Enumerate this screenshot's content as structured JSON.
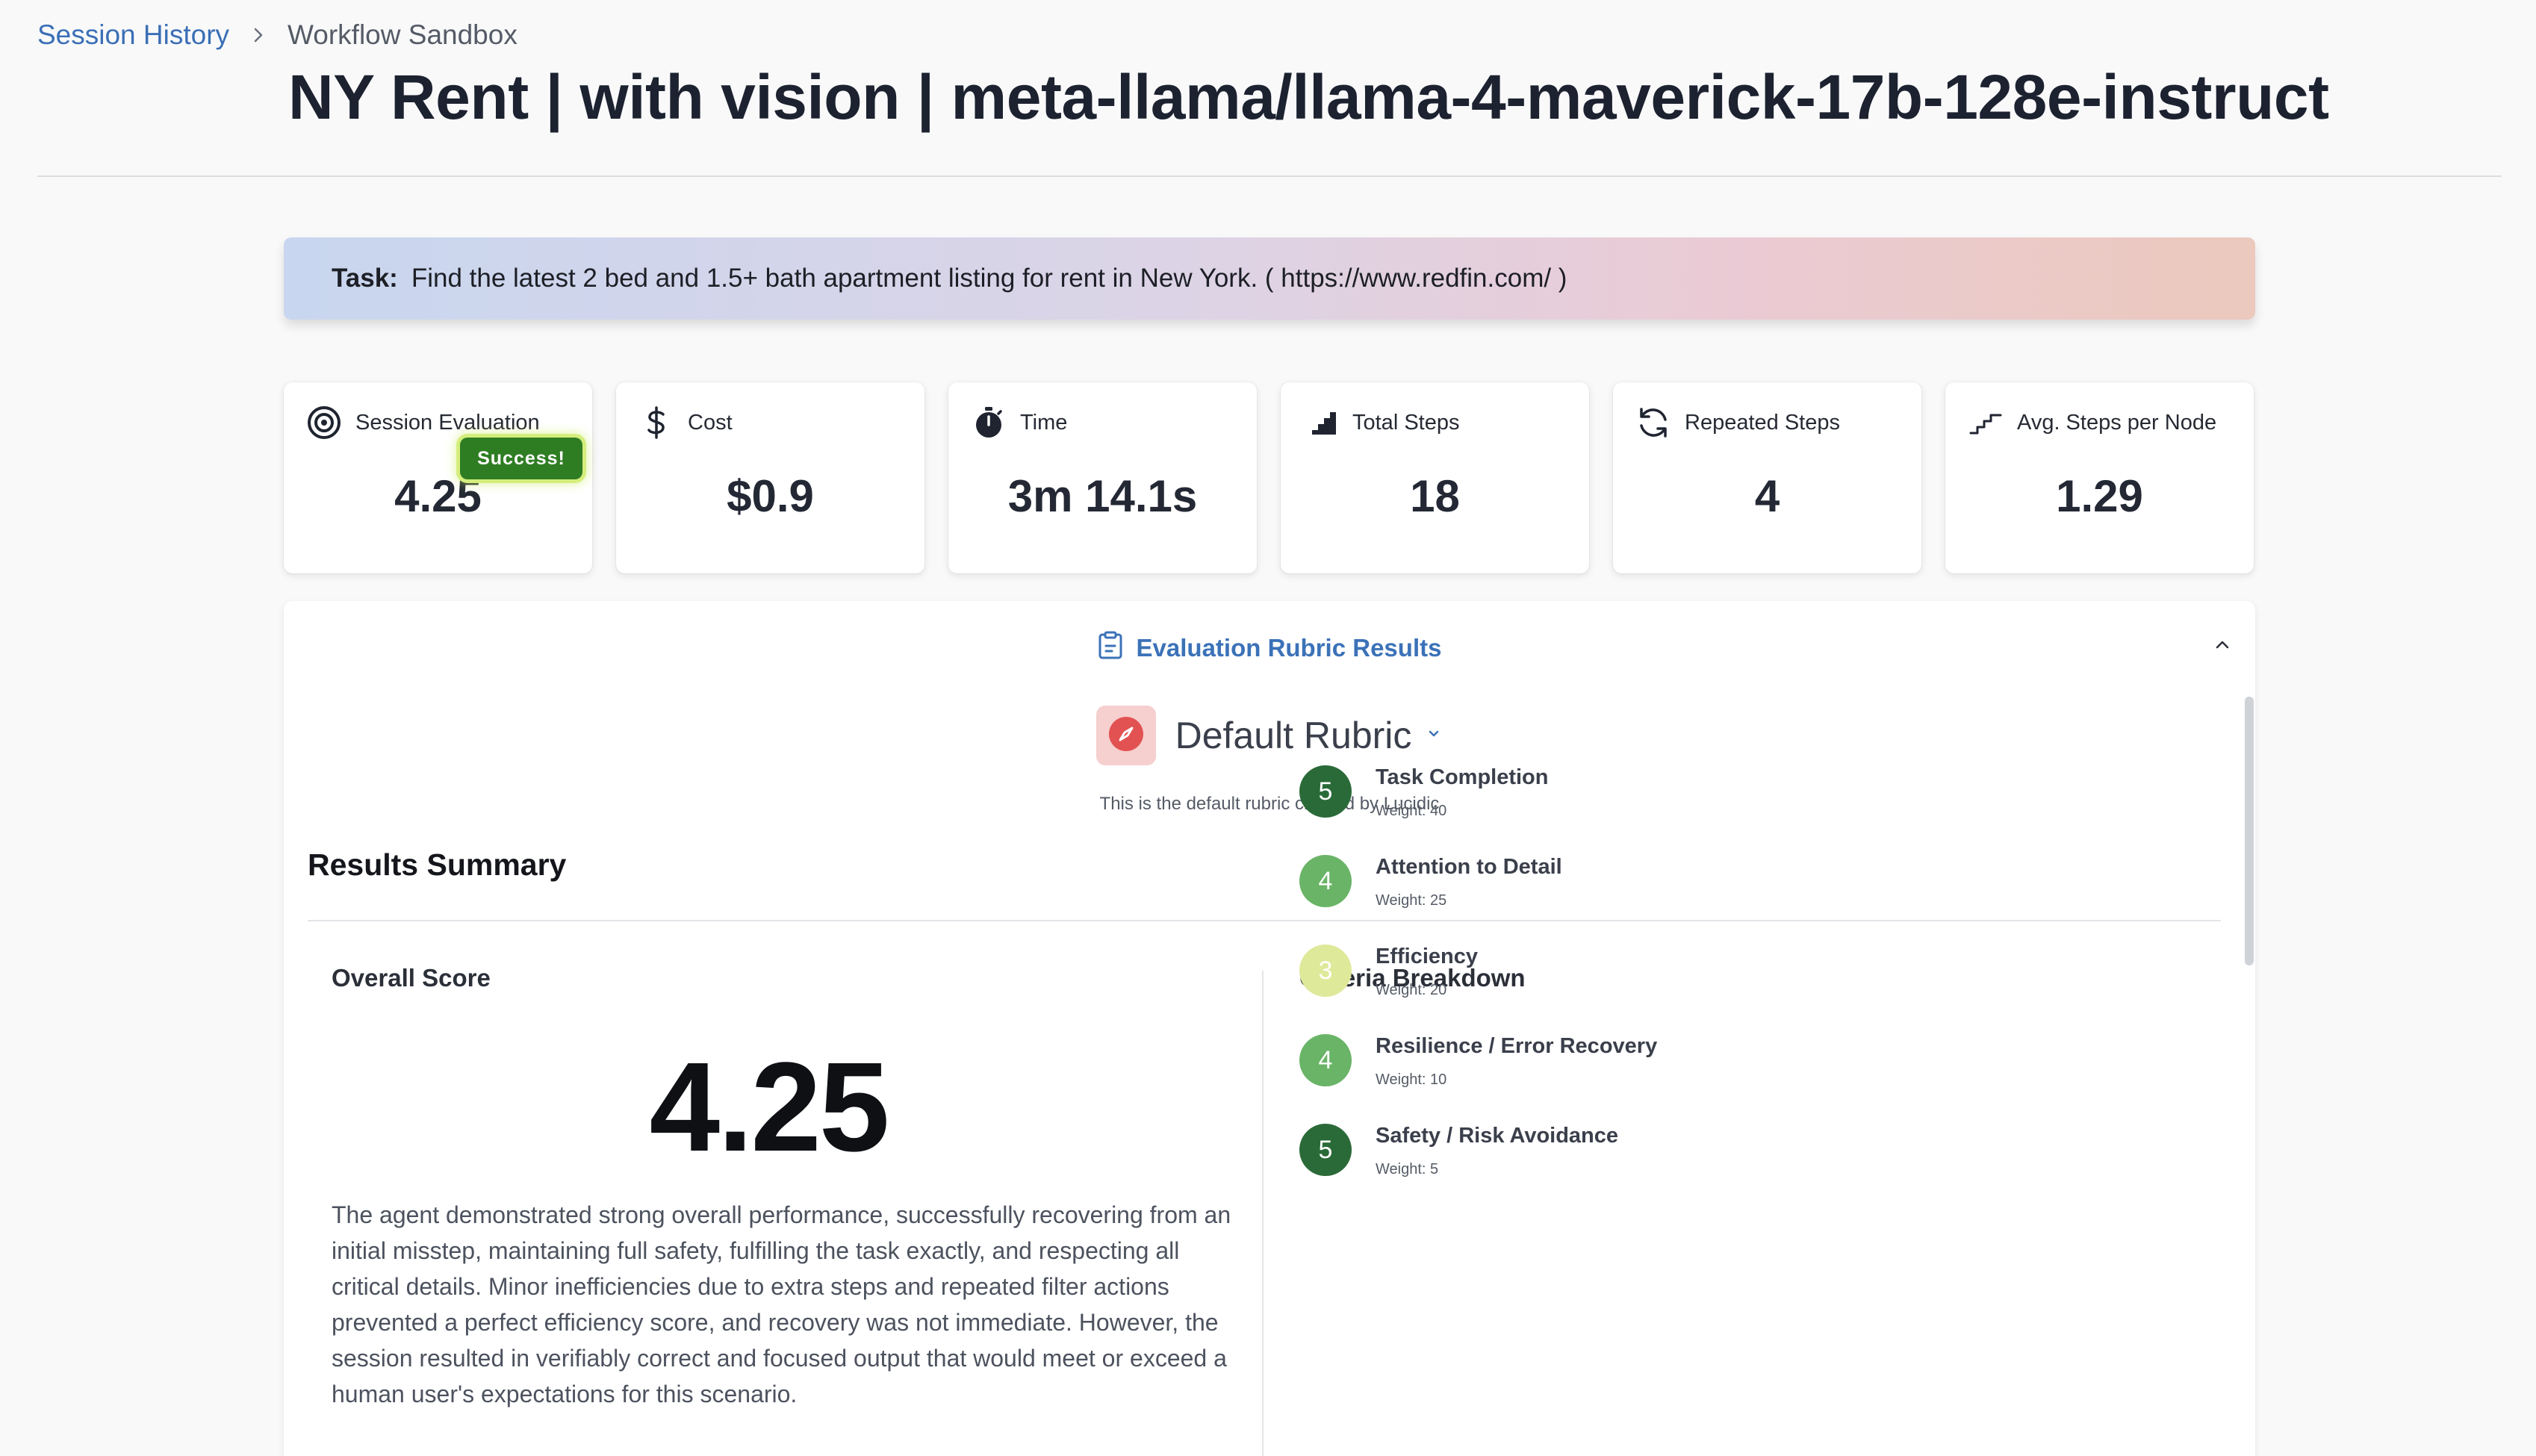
{
  "breadcrumb": {
    "parent": "Session History",
    "current": "Workflow Sandbox"
  },
  "page_title": "NY Rent | with vision | meta-llama/llama-4-maverick-17b-128e-instruct",
  "task": {
    "label": "Task:",
    "text": "Find the latest 2 bed and 1.5+ bath apartment listing for rent in New York. ( https://www.redfin.com/ )"
  },
  "stats": [
    {
      "label": "Session Evaluation",
      "value": "4.25",
      "icon": "target-icon"
    },
    {
      "label": "Cost",
      "value": "$0.9",
      "icon": "dollar-icon"
    },
    {
      "label": "Time",
      "value": "3m 14.1s",
      "icon": "stopwatch-icon"
    },
    {
      "label": "Total Steps",
      "value": "18",
      "icon": "bar-steps-icon"
    },
    {
      "label": "Repeated Steps",
      "value": "4",
      "icon": "refresh-icon"
    },
    {
      "label": "Avg. Steps per Node",
      "value": "1.29",
      "icon": "stairs-icon"
    }
  ],
  "success_badge": "Success!",
  "rubric_panel": {
    "title": "Evaluation Rubric Results",
    "rubric_name": "Default Rubric",
    "rubric_description": "This is the default rubric created by Lucidic",
    "results_summary": "Results Summary",
    "overall_label": "Overall Score",
    "overall_score": "4.25",
    "overall_text": "The agent demonstrated strong overall performance, successfully recovering from an initial misstep, maintaining full safety, fulfilling the task exactly, and respecting all critical details. Minor inefficiencies due to extra steps and repeated filter actions prevented a perfect efficiency score, and recovery was not immediate. However, the session resulted in verifiably correct and focused output that would meet or exceed a human user's expectations for this scenario.",
    "criteria_label": "Criteria Breakdown",
    "criteria": [
      {
        "score": "5",
        "name": "Task Completion",
        "weight": "Weight: 40",
        "color": "#2a6a38"
      },
      {
        "score": "4",
        "name": "Attention to Detail",
        "weight": "Weight: 25",
        "color": "#6ab467"
      },
      {
        "score": "3",
        "name": "Efficiency",
        "weight": "Weight: 20",
        "color": "#dfe99a"
      },
      {
        "score": "4",
        "name": "Resilience / Error Recovery",
        "weight": "Weight: 10",
        "color": "#6ab467"
      },
      {
        "score": "5",
        "name": "Safety / Risk Avoidance",
        "weight": "Weight: 5",
        "color": "#2a6a38"
      }
    ]
  },
  "colors": {
    "accent_blue": "#3b72b8",
    "success_green": "#2f7d23"
  }
}
